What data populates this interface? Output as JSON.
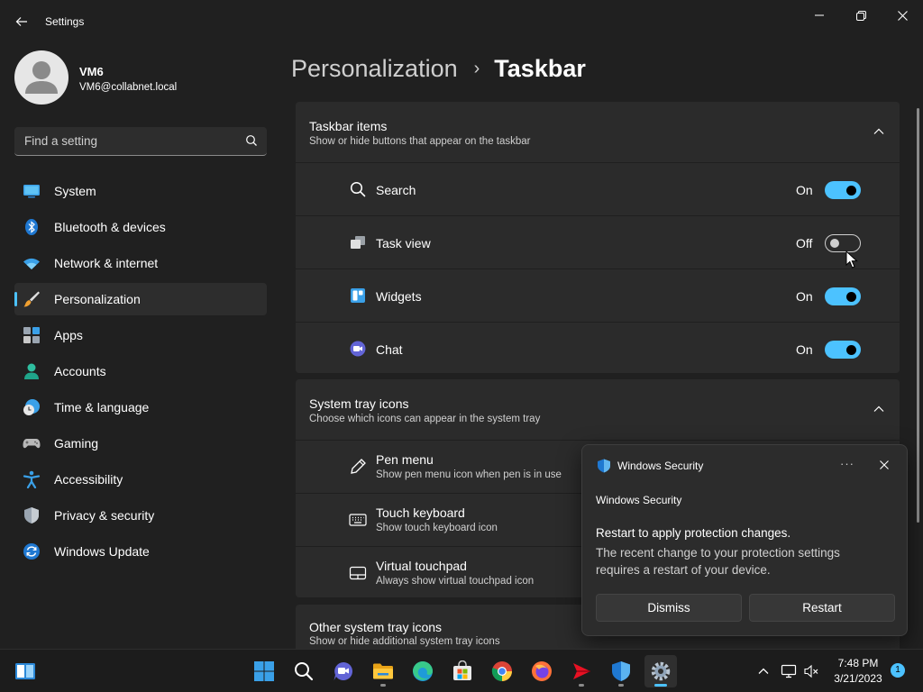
{
  "window": {
    "title": "Settings"
  },
  "user": {
    "name": "VM6",
    "email": "VM6@collabnet.local"
  },
  "search": {
    "placeholder": "Find a setting"
  },
  "sidebar": {
    "items": [
      {
        "label": "System",
        "icon": "system-icon"
      },
      {
        "label": "Bluetooth & devices",
        "icon": "bluetooth-icon"
      },
      {
        "label": "Network & internet",
        "icon": "wifi-icon"
      },
      {
        "label": "Personalization",
        "icon": "brush-icon",
        "active": true
      },
      {
        "label": "Apps",
        "icon": "apps-icon"
      },
      {
        "label": "Accounts",
        "icon": "accounts-icon"
      },
      {
        "label": "Time & language",
        "icon": "clock-globe-icon"
      },
      {
        "label": "Gaming",
        "icon": "gamepad-icon"
      },
      {
        "label": "Accessibility",
        "icon": "accessibility-icon"
      },
      {
        "label": "Privacy & security",
        "icon": "shield-icon"
      },
      {
        "label": "Windows Update",
        "icon": "update-icon"
      }
    ]
  },
  "breadcrumb": {
    "parent": "Personalization",
    "separator": "›",
    "current": "Taskbar"
  },
  "taskbar_items": {
    "title": "Taskbar items",
    "subtitle": "Show or hide buttons that appear on the taskbar",
    "rows": [
      {
        "label": "Search",
        "state": "On",
        "on": true,
        "icon": "search-icon"
      },
      {
        "label": "Task view",
        "state": "Off",
        "on": false,
        "icon": "task-view-icon"
      },
      {
        "label": "Widgets",
        "state": "On",
        "on": true,
        "icon": "widgets-icon"
      },
      {
        "label": "Chat",
        "state": "On",
        "on": true,
        "icon": "chat-icon"
      }
    ]
  },
  "system_tray": {
    "title": "System tray icons",
    "subtitle": "Choose which icons can appear in the system tray",
    "rows": [
      {
        "label": "Pen menu",
        "description": "Show pen menu icon when pen is in use",
        "icon": "pen-icon"
      },
      {
        "label": "Touch keyboard",
        "description": "Show touch keyboard icon",
        "icon": "keyboard-icon"
      },
      {
        "label": "Virtual touchpad",
        "description": "Always show virtual touchpad icon",
        "icon": "touchpad-icon"
      }
    ]
  },
  "other_tray": {
    "title": "Other system tray icons",
    "subtitle": "Show or hide additional system tray icons"
  },
  "toast": {
    "app": "Windows Security",
    "more": "···",
    "source": "Windows Security",
    "heading": "Restart to apply protection changes.",
    "body": "The recent change to your protection settings requires a restart of your device.",
    "dismiss": "Dismiss",
    "restart": "Restart"
  },
  "taskbar": {
    "apps": [
      "start-icon",
      "search-icon",
      "teams-chat-icon",
      "file-explorer-icon",
      "edge-icon",
      "store-icon",
      "chrome-icon",
      "firefox-icon",
      "red-app-icon",
      "defender-shield-icon",
      "settings-gear-icon"
    ],
    "time": "7:48 PM",
    "date": "3/21/2023",
    "notifications": "1"
  },
  "colors": {
    "accent": "#4cc2ff",
    "background": "#202020",
    "card": "#2b2b2b"
  }
}
